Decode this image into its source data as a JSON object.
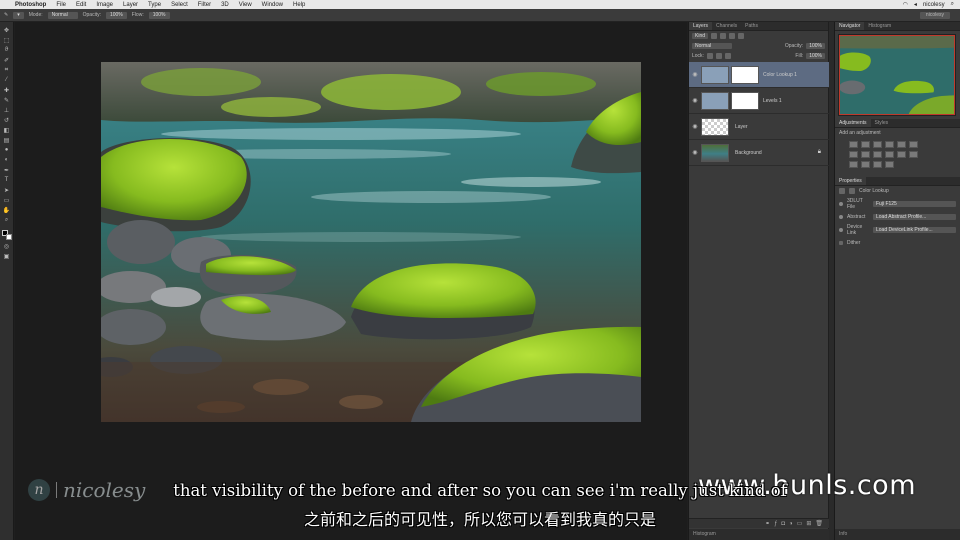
{
  "menubar": {
    "items": [
      "Photoshop",
      "File",
      "Edit",
      "Image",
      "Layer",
      "Type",
      "Select",
      "Filter",
      "3D",
      "View",
      "Window",
      "Help"
    ],
    "user": "nicolesy"
  },
  "options_bar": {
    "mode_label": "Mode:",
    "mode_value": "Normal",
    "opacity_label": "Opacity:",
    "opacity_value": "100%",
    "flow_label": "Flow:",
    "flow_value": "100%",
    "workspace": "nicolesy"
  },
  "toolbar": {
    "tools": [
      "move-tool-icon",
      "marquee-tool-icon",
      "lasso-tool-icon",
      "quick-select-tool-icon",
      "crop-tool-icon",
      "eyedropper-tool-icon",
      "healing-tool-icon",
      "brush-tool-icon",
      "stamp-tool-icon",
      "history-brush-tool-icon",
      "eraser-tool-icon",
      "gradient-tool-icon",
      "blur-tool-icon",
      "dodge-tool-icon",
      "pen-tool-icon",
      "type-tool-icon",
      "path-select-tool-icon",
      "shape-tool-icon",
      "hand-tool-icon",
      "zoom-tool-icon"
    ]
  },
  "layers_panel": {
    "tabs": [
      "Layers",
      "Channels",
      "Paths"
    ],
    "kind_label": "Kind",
    "blend_mode": "Normal",
    "opacity_label": "Opacity:",
    "opacity_value": "100%",
    "lock_label": "Lock:",
    "fill_label": "Fill:",
    "fill_value": "100%",
    "layers": [
      {
        "name": "Color Lookup 1",
        "selected": true,
        "type": "adjustment"
      },
      {
        "name": "Levels 1",
        "selected": false,
        "type": "adjustment"
      },
      {
        "name": "Layer",
        "selected": false,
        "type": "blank"
      },
      {
        "name": "Background",
        "selected": false,
        "type": "image"
      }
    ],
    "bottom_tab": "Histogram"
  },
  "right_panels": {
    "navigator_tabs": [
      "Navigator",
      "Histogram"
    ],
    "adjustments_tabs": [
      "Adjustments",
      "Styles"
    ],
    "add_adjustment_label": "Add an adjustment",
    "properties_tab": "Properties",
    "properties_title": "Color Lookup",
    "rows": [
      {
        "label": "3DLUT File",
        "value": "Fuji F125"
      },
      {
        "label": "Abstract",
        "value": "Load Abstract Profile..."
      },
      {
        "label": "Device Link",
        "value": "Load DeviceLink Profile..."
      }
    ],
    "dither_label": "Dither",
    "bottom_tab": "Info"
  },
  "overlay": {
    "logo_letter": "n",
    "logo_name": "nicolesy",
    "site": "www.hunls.com",
    "subtitle_en": "that visibility of the before and after so you can see i'm really just kind of",
    "subtitle_zh": "之前和之后的可见性，所以您可以看到我真的只是"
  }
}
